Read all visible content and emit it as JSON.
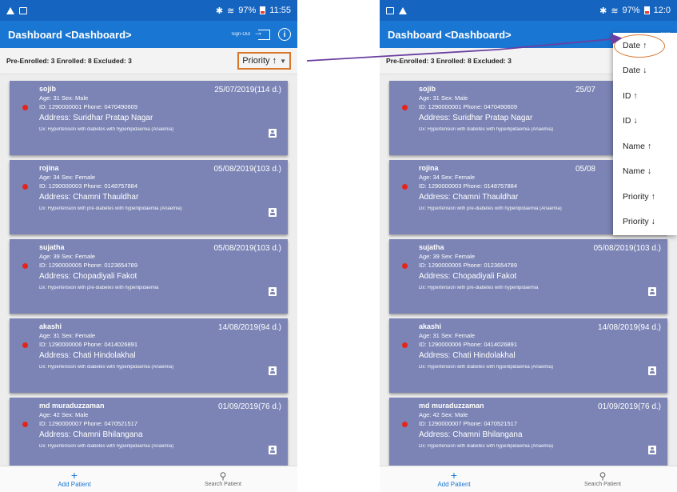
{
  "status_bar": {
    "battery": "97%",
    "time_left": "11:55",
    "time_right": "12:0"
  },
  "app_bar": {
    "title": "Dashboard <Dashboard>",
    "sign_out": "Sign-Out"
  },
  "counts": "Pre-Enrolled: 3  Enrolled: 8  Excluded: 3",
  "sort": {
    "selected": "Priority ↑",
    "expand_icon": "chevron-down-icon"
  },
  "patients": [
    {
      "name": "sojib",
      "date": "25/07/2019(114 d.)",
      "date_short": "25/07",
      "age_sex": "Age: 31   Sex: Male",
      "id_phone": "ID: 1290000001   Phone: 0470490609",
      "address": "Address: Suridhar Pratap Nagar",
      "dx": "Dx: Hypertension with diabetes with hyperlipidaemia (Anaemia)"
    },
    {
      "name": "rojina",
      "date": "05/08/2019(103 d.)",
      "date_short": "05/08",
      "age_sex": "Age: 34   Sex: Female",
      "id_phone": "ID: 1290000003   Phone: 0148757884",
      "address": "Address: Chamni Thauldhar",
      "dx": "Dx: Hypertension with pre-diabetes with hyperlipidaemia (Anaemia)"
    },
    {
      "name": "sujatha",
      "date": "05/08/2019(103 d.)",
      "date_short": "05/08/2019(103 d.)",
      "age_sex": "Age: 39   Sex: Female",
      "id_phone": "ID: 1290000005   Phone: 0123654789",
      "address": "Address: Chopadiyali Fakot",
      "dx": "Dx: Hypertension with pre-diabetes with hyperlipidaemia"
    },
    {
      "name": "akashi",
      "date": "14/08/2019(94 d.)",
      "date_short": "14/08/2019(94 d.)",
      "age_sex": "Age: 31   Sex: Female",
      "id_phone": "ID: 1290000006   Phone: 0414026891",
      "address": "Address: Chati Hindolakhal",
      "dx": "Dx: Hypertension with diabetes with hyperlipidaemia (Anaemia)"
    },
    {
      "name": "md muraduzzaman",
      "date": "01/09/2019(76 d.)",
      "date_short": "01/09/2019(76 d.)",
      "age_sex": "Age: 42   Sex: Male",
      "id_phone": "ID: 1290000007   Phone: 0470521517",
      "address": "Address: Chamni Bhilangana",
      "dx": "Dx: Hypertension with diabetes with hyperlipidaemia (Anaemia)"
    }
  ],
  "bottom_nav": {
    "add": "Add Patient",
    "search": "Search Patient"
  },
  "sort_menu": [
    "Date ↑",
    "Date ↓",
    "ID ↑",
    "ID ↓",
    "Name ↑",
    "Name ↓",
    "Priority ↑",
    "Priority ↓"
  ],
  "colors": {
    "status_bar": "#1565c0",
    "app_bar": "#1976d2",
    "card": "#7b84b5",
    "priority_dot": "#e5251b",
    "highlight": "#d9782d",
    "connector": "#6a3fa0"
  }
}
